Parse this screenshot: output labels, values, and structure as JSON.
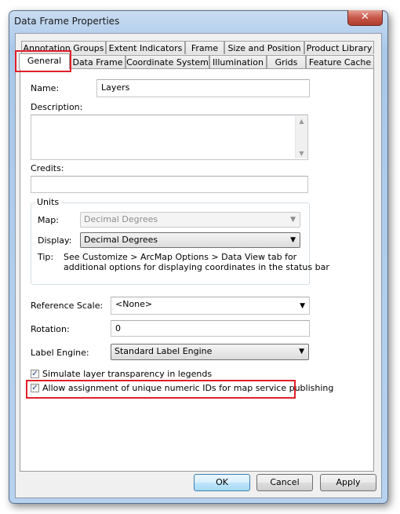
{
  "window": {
    "title": "Data Frame Properties",
    "close_glyph": "✕"
  },
  "tabs": {
    "row_back": [
      {
        "label": "Annotation Groups"
      },
      {
        "label": "Extent Indicators"
      },
      {
        "label": "Frame"
      },
      {
        "label": "Size and Position"
      },
      {
        "label": "Product Library"
      }
    ],
    "row_front": [
      {
        "label": "General",
        "active": true
      },
      {
        "label": "Data Frame"
      },
      {
        "label": "Coordinate System"
      },
      {
        "label": "Illumination"
      },
      {
        "label": "Grids"
      },
      {
        "label": "Feature Cache"
      }
    ]
  },
  "general": {
    "name_label": "Name:",
    "name_value": "Layers",
    "description_label": "Description:",
    "description_value": "",
    "credits_label": "Credits:",
    "credits_value": "",
    "units": {
      "group_label": "Units",
      "map_label": "Map:",
      "map_value": "Decimal Degrees",
      "display_label": "Display:",
      "display_value": "Decimal Degrees",
      "tip_label": "Tip:",
      "tip_line1": "See Customize > ArcMap Options > Data View tab for",
      "tip_line2": "additional options for displaying coordinates in the status bar"
    },
    "reference_scale_label": "Reference Scale:",
    "reference_scale_value": "<None>",
    "rotation_label": "Rotation:",
    "rotation_value": "0",
    "label_engine_label": "Label Engine:",
    "label_engine_value": "Standard Label Engine",
    "simulate_transparency": {
      "label": "Simulate layer transparency in legends",
      "checked": true
    },
    "allow_unique_ids": {
      "label": "Allow assignment of unique numeric IDs for map service publishing",
      "checked": true
    }
  },
  "icons": {
    "check": "✓",
    "dropdown": "▼",
    "scroll_up": "▲",
    "scroll_down": "▼"
  },
  "buttons": {
    "ok": "OK",
    "cancel": "Cancel",
    "apply": "Apply"
  },
  "highlight_color": "#e0202a"
}
